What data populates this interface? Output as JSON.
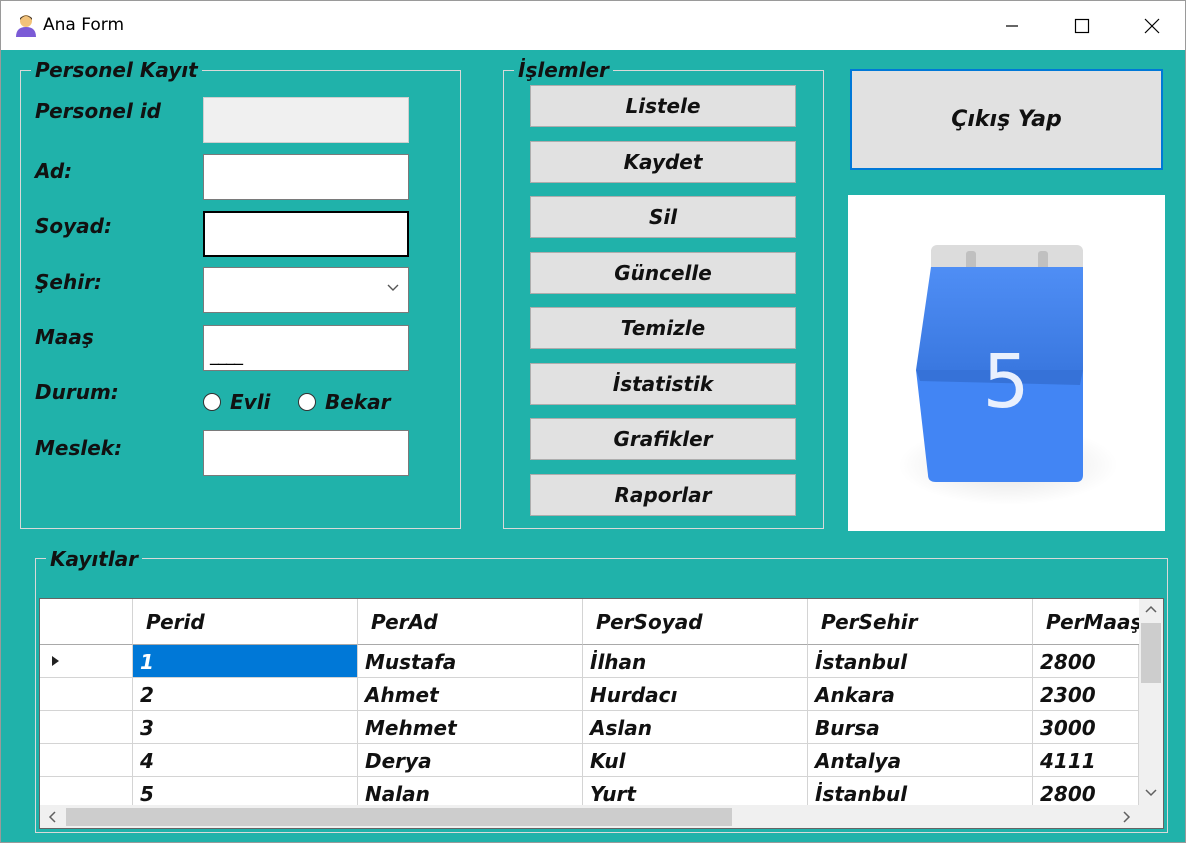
{
  "window": {
    "title": "Ana Form",
    "icon": "user-avatar-icon",
    "controls": [
      "minimize-icon",
      "maximize-icon",
      "close-icon"
    ]
  },
  "personel": {
    "legend": "Personel Kayıt",
    "id_label": "Personel id",
    "id_value": "",
    "ad_label": "Ad:",
    "ad_value": "",
    "soyad_label": "Soyad:",
    "soyad_value": "",
    "sehir_label": "Şehir:",
    "sehir_value": "",
    "maas_label": "Maaş",
    "maas_mask": "____",
    "durum_label": "Durum:",
    "durum_options": [
      "Evli",
      "Bekar"
    ],
    "meslek_label": "Meslek:",
    "meslek_value": ""
  },
  "islemler": {
    "legend": "İşlemler",
    "buttons": [
      "Listele",
      "Kaydet",
      "Sil",
      "Güncelle",
      "Temizle",
      "İstatistik",
      "Grafikler",
      "Raporlar"
    ]
  },
  "exit_label": "Çıkış Yap",
  "picture": {
    "icon": "calendar-icon",
    "number": "5"
  },
  "kayitlar": {
    "legend": "Kayıtlar",
    "columns": [
      "Perid",
      "PerAd",
      "PerSoyad",
      "PerSehir",
      "PerMaaş"
    ],
    "rows": [
      [
        "1",
        "Mustafa",
        "İlhan",
        "İstanbul",
        "2800"
      ],
      [
        "2",
        "Ahmet",
        "Hurdacı",
        "Ankara",
        "2300"
      ],
      [
        "3",
        "Mehmet",
        "Aslan",
        "Bursa",
        "3000"
      ],
      [
        "4",
        "Derya",
        "Kul",
        "Antalya",
        "4111"
      ],
      [
        "5",
        "Nalan",
        "Yurt",
        "İstanbul",
        "2800"
      ]
    ]
  },
  "colors": {
    "background": "#20B2AA",
    "selection": "#0078d7",
    "button": "#e1e1e1",
    "calendar_blue": "#4285F4"
  }
}
